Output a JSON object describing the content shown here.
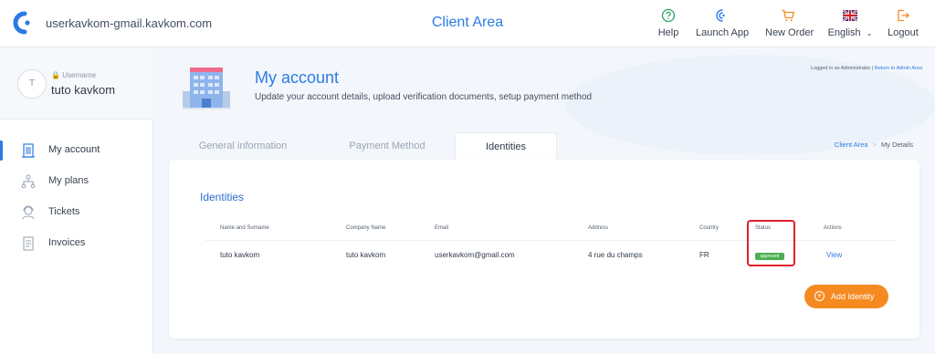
{
  "topbar": {
    "account_domain": "userkavkom-gmail.kavkom.com",
    "app_title": "Client Area",
    "actions": [
      {
        "label": "Help",
        "icon": "help-circle-icon"
      },
      {
        "label": "Launch App",
        "icon": "wireless-icon"
      },
      {
        "label": "New Order",
        "icon": "cart-icon"
      },
      {
        "label": "English",
        "icon": "uk-flag-icon"
      },
      {
        "label": "Logout",
        "icon": "logout-icon"
      }
    ]
  },
  "sidebar": {
    "user": {
      "initial": "T",
      "caption": "Username",
      "name": "tuto kavkom"
    },
    "items": [
      {
        "label": "My account",
        "icon": "building-icon",
        "active": true
      },
      {
        "label": "My plans",
        "icon": "org-chart-icon"
      },
      {
        "label": "Tickets",
        "icon": "support-icon"
      },
      {
        "label": "Invoices",
        "icon": "invoice-icon"
      }
    ]
  },
  "page": {
    "title": "My account",
    "subtitle": "Update your account details, upload verification documents, setup payment method",
    "logged_in_text": "Logged in as Administrator",
    "logged_in_separator": "|",
    "return_link": "Return to Admin Area"
  },
  "tabs": [
    {
      "label": "General information"
    },
    {
      "label": "Payment Method"
    },
    {
      "label": "Identities",
      "active": true
    }
  ],
  "breadcrumb": {
    "parent": "Client Area",
    "separator": ">",
    "current": "My Details"
  },
  "identities": {
    "title": "Identities",
    "columns": [
      "Name and Surname",
      "Company Name",
      "Email",
      "Address",
      "Country",
      "Status",
      "Actions"
    ],
    "rows": [
      {
        "name": "tuto kavkom",
        "company": "tuto kavkom",
        "email": "userkavkom@gmail.com",
        "address": "4 rue du champs",
        "country": "FR",
        "status": "approved",
        "action": "View"
      }
    ],
    "add_button": "Add Identity"
  },
  "colors": {
    "accent": "#2c7be5",
    "status_approved": "#4caf50",
    "add_button": "#f58a21",
    "highlight": "#e0202a"
  }
}
